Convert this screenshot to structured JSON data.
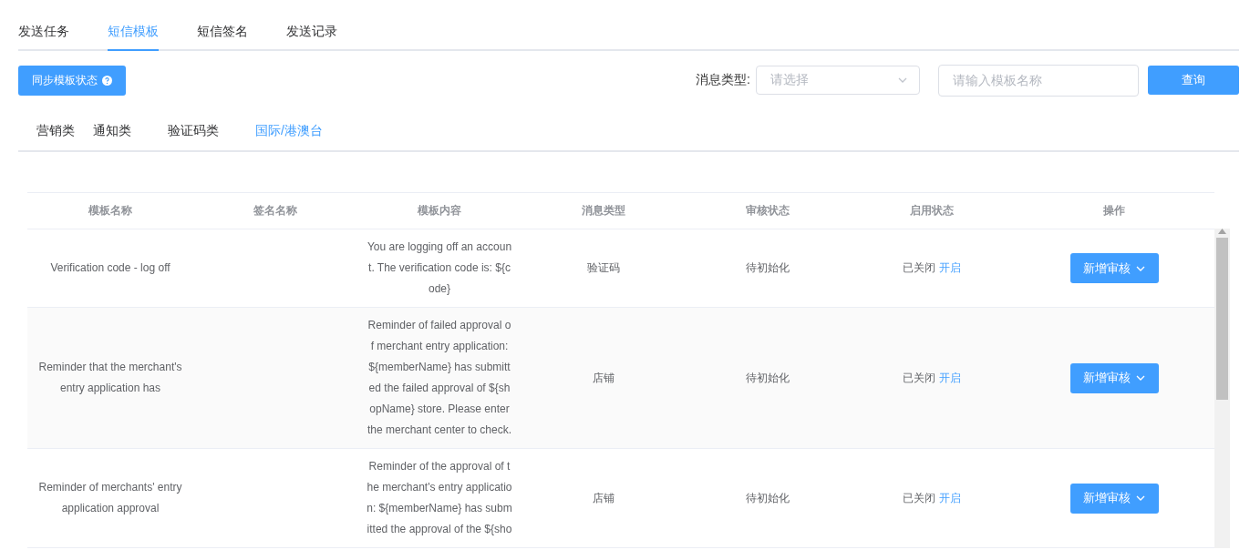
{
  "tabs": [
    {
      "label": "发送任务",
      "selected": false
    },
    {
      "label": "短信模板",
      "selected": true
    },
    {
      "label": "短信签名",
      "selected": false
    },
    {
      "label": "发送记录",
      "selected": false
    }
  ],
  "sync_button": {
    "label": "同步模板状态"
  },
  "filter": {
    "label": "消息类型:",
    "select_placeholder": "请选择",
    "search_placeholder": "请输入模板名称",
    "query_button": "查询"
  },
  "category_tabs": [
    {
      "label": "营销类",
      "selected": false
    },
    {
      "label": "通知类",
      "selected": false
    },
    {
      "label": "验证码类",
      "selected": false
    },
    {
      "label": "国际/港澳台",
      "selected": true
    }
  ],
  "table": {
    "columns": [
      "模板名称",
      "签名名称",
      "模板内容",
      "消息类型",
      "审核状态",
      "启用状态",
      "操作"
    ],
    "rows": [
      {
        "name": "Verification code - log off",
        "content_lines": [
          "You are logging off an accoun",
          "t. The verification code is: ${c",
          "ode}"
        ],
        "message_type": "验证码",
        "audit_status": "待初始化",
        "enable_status": "已关闭",
        "enable_link": "开启",
        "action": "新增审核"
      },
      {
        "name": "Reminder that the merchant's entry application has",
        "content_lines": [
          "Reminder of failed approval o",
          "f merchant entry application:",
          "${memberName} has submitt",
          "ed the failed approval of ${sh",
          "opName} store. Please enter",
          "the merchant center to check."
        ],
        "message_type": "店铺",
        "audit_status": "待初始化",
        "enable_status": "已关闭",
        "enable_link": "开启",
        "action": "新增审核"
      },
      {
        "name": "Reminder of merchants' entry application approval",
        "content_lines": [
          "Reminder of the approval of t",
          "he merchant's entry applicatio",
          "n: ${memberName} has subm",
          "itted the approval of the ${sho"
        ],
        "message_type": "店铺",
        "audit_status": "待初始化",
        "enable_status": "已关闭",
        "enable_link": "开启",
        "action": "新增审核"
      }
    ]
  }
}
